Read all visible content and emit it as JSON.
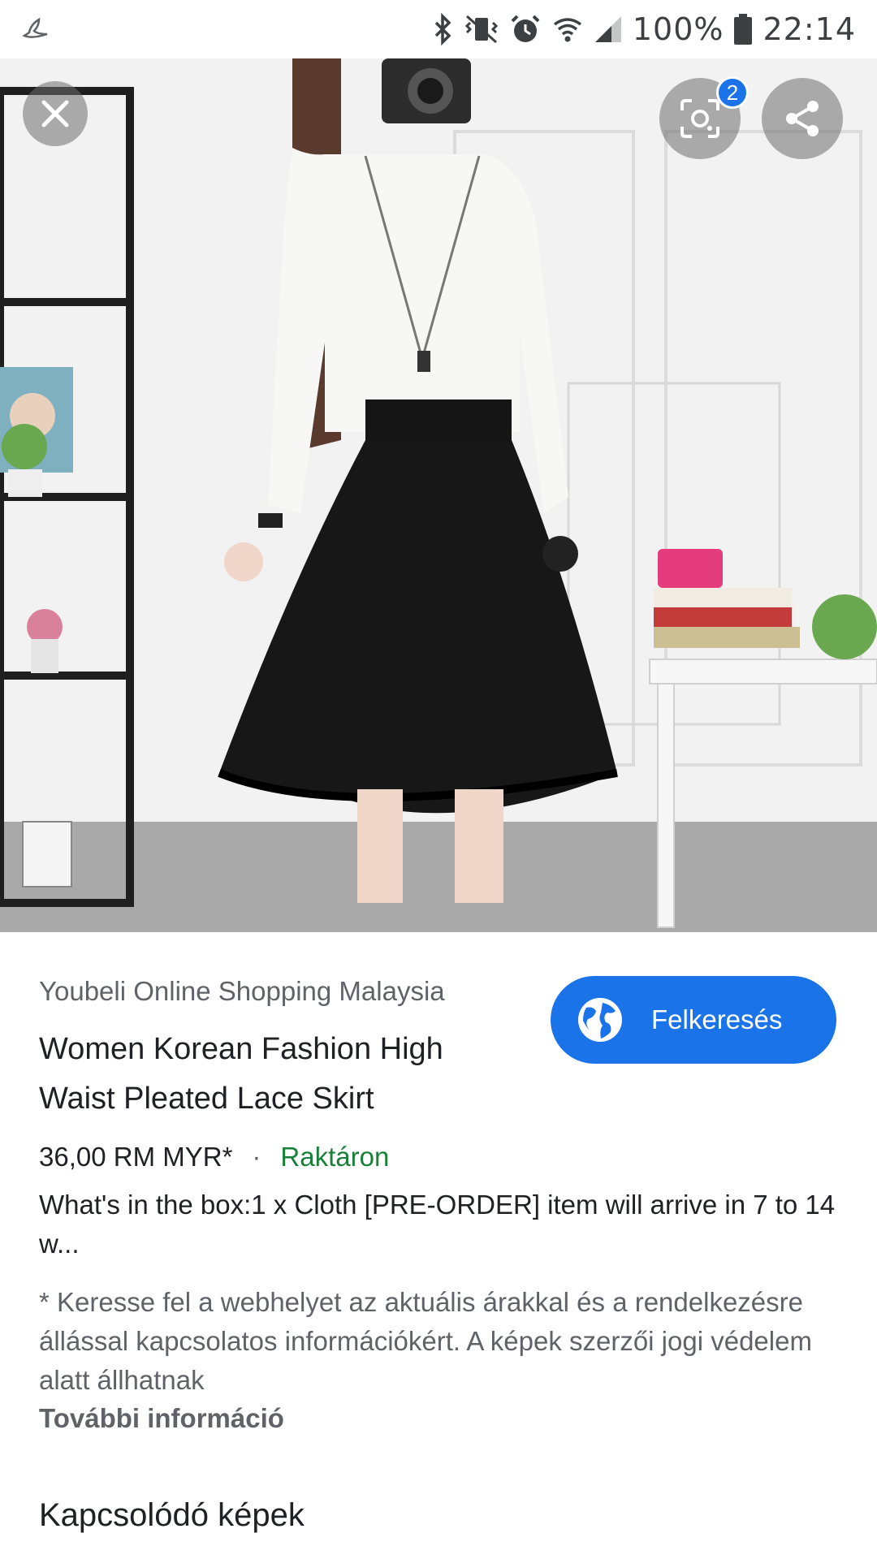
{
  "status_bar": {
    "battery": "100%",
    "time": "22:14",
    "icons": [
      "app-notification-icon",
      "bluetooth-icon",
      "vibrate-icon",
      "alarm-icon",
      "wifi-icon",
      "signal-icon",
      "battery-icon"
    ]
  },
  "viewer": {
    "lens_badge": "2",
    "icons": [
      "close-icon",
      "lens-icon",
      "share-icon"
    ]
  },
  "result": {
    "source": "Youbeli Online Shopping Malaysia",
    "title": "Women Korean Fashion High Waist Pleated Lace Skirt",
    "visit_label": "Felkeresés",
    "price": "36,00 RM MYR*",
    "separator": "·",
    "availability": "Raktáron",
    "description": "What's in the box:1 x Cloth [PRE-ORDER] item will arrive in 7 to 14 w...",
    "disclaimer": "* Keresse fel a webhelyet az aktuális árakkal és a rendelkezésre állással kapcsolatos információkért. A képek szerzői jogi védelem alatt állhatnak",
    "more_info": "További információ",
    "related_heading": "Kapcsolódó képek"
  },
  "colors": {
    "accent": "#1a73e8",
    "in_stock": "#188038",
    "secondary_text": "#5f6368"
  }
}
